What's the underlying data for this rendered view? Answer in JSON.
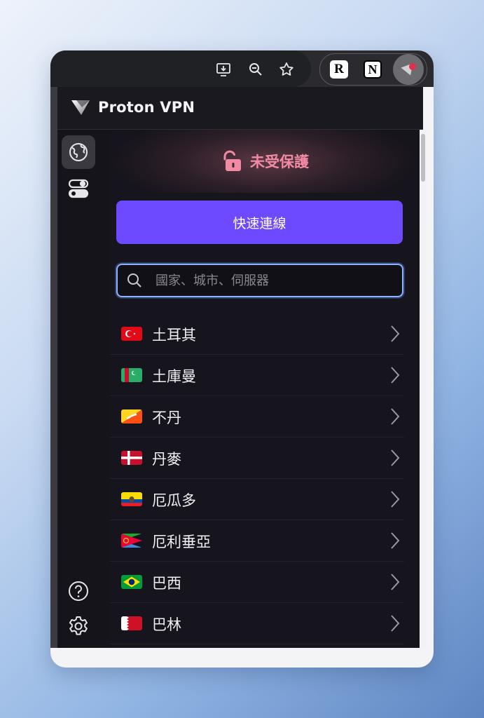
{
  "browser": {
    "toolbar_icons": [
      "install-app-icon",
      "zoom-out-icon",
      "bookmark-star-icon"
    ],
    "extensions": [
      {
        "name": "r-extension-icon",
        "glyph": "R"
      },
      {
        "name": "notion-extension-icon",
        "glyph": "N"
      },
      {
        "name": "proton-vpn-extension-icon"
      }
    ]
  },
  "app": {
    "brand": "Proton VPN",
    "status": "未受保護",
    "connect_label": "快速連線",
    "search_placeholder": "國家、城市、伺服器"
  },
  "countries": [
    {
      "label": "土耳其",
      "flag": "turkey"
    },
    {
      "label": "土庫曼",
      "flag": "turkmenistan"
    },
    {
      "label": "不丹",
      "flag": "bhutan"
    },
    {
      "label": "丹麥",
      "flag": "denmark"
    },
    {
      "label": "厄瓜多",
      "flag": "ecuador"
    },
    {
      "label": "厄利垂亞",
      "flag": "eritrea"
    },
    {
      "label": "巴西",
      "flag": "brazil"
    },
    {
      "label": "巴林",
      "flag": "bahrain"
    }
  ],
  "colors": {
    "accent": "#6d4aff",
    "unprotected": "#f28aa3",
    "background": "#16141c"
  }
}
